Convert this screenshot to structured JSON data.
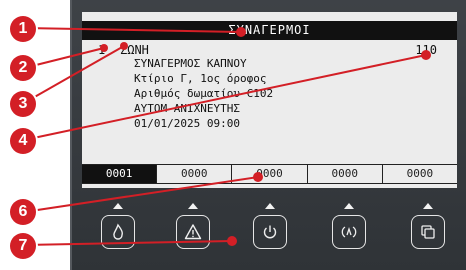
{
  "screen": {
    "title": "ΣΥΝΑΓΕΡΜΟΙ",
    "zone_number": "1",
    "zone_label": "ΖΩΝΗ",
    "zone_code": "110",
    "details": [
      "ΣΥΝΑΓΕΡΜΟΣ ΚΑΠΝΟΥ",
      "Κτίριο Γ, 1ος όροφος",
      "Αριθμός δωματίου C102",
      "ΑΥΤΟΜ-ΑΝΙΧΝΕΥΤΗΣ",
      "01/01/2025 09:00"
    ],
    "counters": [
      "0001",
      "0000",
      "0000",
      "0000",
      "0000"
    ]
  },
  "buttons": [
    {
      "icon": "fire-icon"
    },
    {
      "icon": "warning-icon"
    },
    {
      "icon": "power-icon"
    },
    {
      "icon": "signal-icon"
    },
    {
      "icon": "pages-icon"
    }
  ],
  "callouts": [
    "1",
    "2",
    "3",
    "4",
    "6",
    "7"
  ],
  "colors": {
    "callout": "#d31f26",
    "panel": "#35393d",
    "screen": "#ececec"
  }
}
